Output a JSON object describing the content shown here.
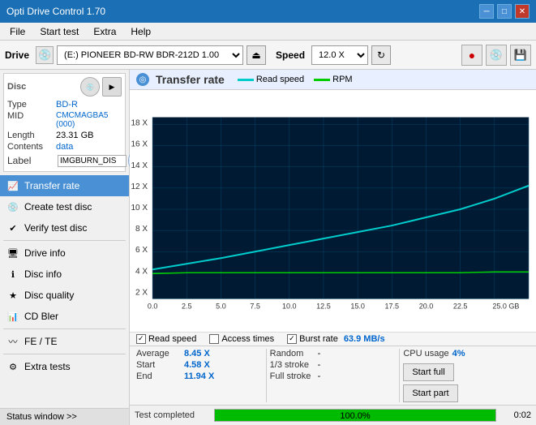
{
  "titlebar": {
    "title": "Opti Drive Control 1.70",
    "minimize": "─",
    "maximize": "□",
    "close": "✕"
  },
  "menubar": {
    "items": [
      "File",
      "Start test",
      "Extra",
      "Help"
    ]
  },
  "toolbar": {
    "drive_label": "Drive",
    "drive_value": "(E:)  PIONEER BD-RW   BDR-212D 1.00",
    "speed_label": "Speed",
    "speed_value": "12.0 X ▾"
  },
  "disc": {
    "type_label": "Type",
    "type_value": "BD-R",
    "mid_label": "MID",
    "mid_value": "CMCMAGBA5 (000)",
    "length_label": "Length",
    "length_value": "23.31 GB",
    "contents_label": "Contents",
    "contents_value": "data",
    "label_label": "Label",
    "label_value": "IMGBURN_DIS"
  },
  "nav": {
    "items": [
      {
        "id": "transfer-rate",
        "label": "Transfer rate",
        "active": true
      },
      {
        "id": "create-test-disc",
        "label": "Create test disc",
        "active": false
      },
      {
        "id": "verify-test-disc",
        "label": "Verify test disc",
        "active": false
      },
      {
        "id": "drive-info",
        "label": "Drive info",
        "active": false
      },
      {
        "id": "disc-info",
        "label": "Disc info",
        "active": false
      },
      {
        "id": "disc-quality",
        "label": "Disc quality",
        "active": false
      },
      {
        "id": "cd-bler",
        "label": "CD Bler",
        "active": false
      },
      {
        "id": "fe-te",
        "label": "FE / TE",
        "active": false
      },
      {
        "id": "extra-tests",
        "label": "Extra tests",
        "active": false
      }
    ]
  },
  "status_window": "Status window >>",
  "chart": {
    "title": "Transfer rate",
    "legend": {
      "read_speed": "Read speed",
      "rpm": "RPM"
    },
    "y_axis": [
      "18 X",
      "16 X",
      "14 X",
      "12 X",
      "10 X",
      "8 X",
      "6 X",
      "4 X",
      "2 X"
    ],
    "x_axis": [
      "0.0",
      "2.5",
      "5.0",
      "7.5",
      "10.0",
      "12.5",
      "15.0",
      "17.5",
      "20.0",
      "22.5",
      "25.0 GB"
    ]
  },
  "checkboxes": {
    "read_speed": {
      "label": "Read speed",
      "checked": true
    },
    "access_times": {
      "label": "Access times",
      "checked": false
    },
    "burst_rate": {
      "label": "Burst rate",
      "checked": true
    },
    "burst_value": "63.9 MB/s"
  },
  "stats": {
    "average_label": "Average",
    "average_value": "8.45 X",
    "random_label": "Random",
    "random_value": "-",
    "cpu_label": "CPU usage",
    "cpu_value": "4%",
    "start_label": "Start",
    "start_value": "4.58 X",
    "stroke13_label": "1/3 stroke",
    "stroke13_value": "-",
    "start_full_label": "Start full",
    "end_label": "End",
    "end_value": "11.94 X",
    "full_stroke_label": "Full stroke",
    "full_stroke_value": "-",
    "start_part_label": "Start part"
  },
  "progress": {
    "label": "Test completed",
    "pct": "100.0%",
    "fill_pct": 100,
    "time": "0:02"
  }
}
